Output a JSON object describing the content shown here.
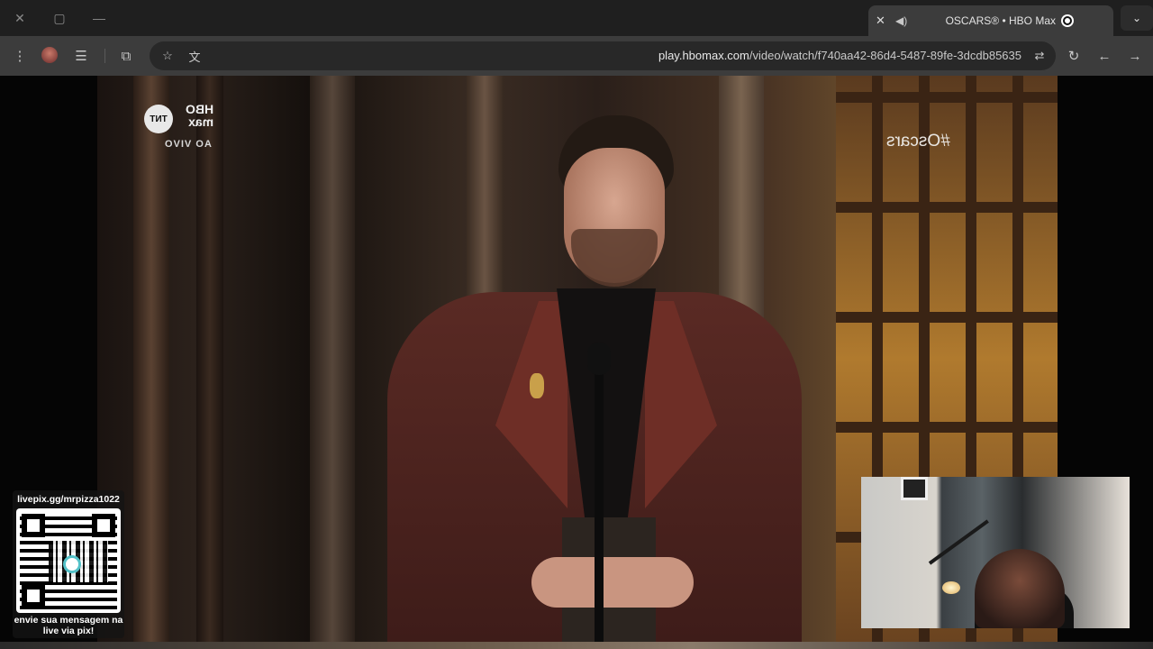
{
  "browser": {
    "tab": {
      "title": "OSCARS® • HBO Max"
    },
    "url": {
      "host": "play.hbomax.com",
      "path": "/video/watch/f740aa42-86d4-5487-89fe-3dcdb85635"
    },
    "window_controls": {
      "close": "✕",
      "maximize": "▢",
      "minimize": "—"
    },
    "new_tab": "+",
    "tab_close": "✕",
    "tab_audio": "◀)",
    "tab_list": "⌄"
  },
  "toolbar": {
    "menu": "⋮",
    "reading_list": "☰",
    "extensions": "⧉",
    "bookmark": "☆",
    "translate": "文",
    "site_info": "⇄",
    "reload": "↻",
    "back": "←",
    "forward": "→"
  },
  "video": {
    "hashtag": "#Oscars",
    "logo_tnt": "TNT",
    "logo_hbo_line1": "HBO",
    "logo_hbo_line2": "max",
    "live_label": "AO VIVO"
  },
  "overlay": {
    "qr_top": "livepix.gg/mrpizza1022",
    "qr_bottom_line1": "envie sua mensagem na",
    "qr_bottom_line2": "live via pix!"
  }
}
